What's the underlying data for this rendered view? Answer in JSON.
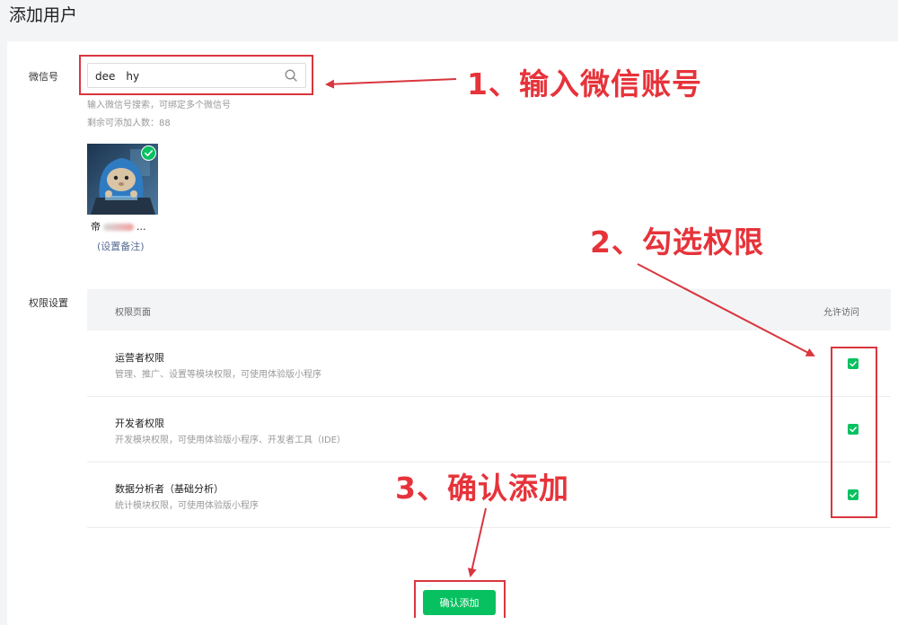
{
  "page": {
    "title": "添加用户"
  },
  "wechat": {
    "label": "微信号",
    "search_value": "dee　hy",
    "hint": "输入微信号搜索，可绑定多个微信号",
    "remaining": "剩余可添加人数：88"
  },
  "user": {
    "name_start": "帝",
    "name_end": "...",
    "remark_link": "(设置备注)"
  },
  "permissions": {
    "label": "权限设置",
    "col_page": "权限页面",
    "col_allow": "允许访问",
    "rows": [
      {
        "title": "运营者权限",
        "desc": "管理、推广、设置等模块权限，可使用体验版小程序",
        "checked": true
      },
      {
        "title": "开发者权限",
        "desc": "开发模块权限，可使用体验版小程序、开发者工具（IDE）",
        "checked": true
      },
      {
        "title": "数据分析者（基础分析）",
        "desc": "统计模块权限，可使用体验版小程序",
        "checked": true
      }
    ]
  },
  "confirm_button": "确认添加",
  "annotations": {
    "step1": "1、输入微信账号",
    "step2": "2、勾选权限",
    "step3": "3、确认添加",
    "color": "#e6333a"
  },
  "colors": {
    "primary_green": "#07c160",
    "link_blue": "#576b95",
    "annotation_red": "#d9363e"
  }
}
